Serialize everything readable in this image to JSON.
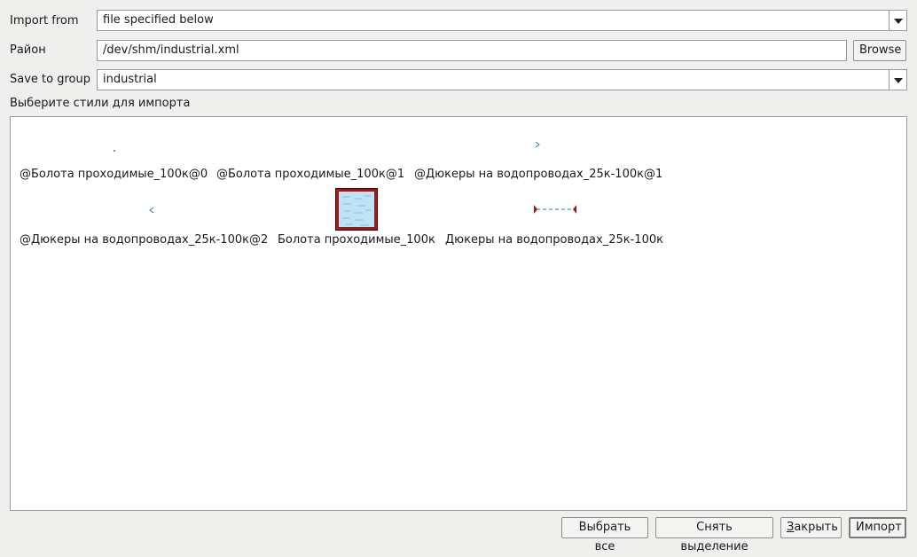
{
  "import_from": {
    "label": "Import from",
    "value": "file specified below"
  },
  "file": {
    "label": "Район",
    "value": "/dev/shm/industrial.xml",
    "browse_label": "Browse"
  },
  "save_to_group": {
    "label": "Save to group",
    "value": "industrial"
  },
  "styles_heading": "Выберите стили для импорта",
  "styles": [
    {
      "name": "@Болота проходимые_100к@0",
      "icon": "dot-marker-icon"
    },
    {
      "name": "@Болота проходимые_100к@1",
      "icon": "empty-preview"
    },
    {
      "name": "@Дюкеры на водопроводах_25к-100к@1",
      "icon": "chevron-right-icon"
    },
    {
      "name": "@Дюкеры на водопроводах_25к-100к@2",
      "icon": "chevron-left-icon"
    },
    {
      "name": "Болота проходимые_100к",
      "icon": "swamp-fill-icon"
    },
    {
      "name": "Дюкеры на водопроводах_25к-100к",
      "icon": "dashed-line-icon"
    }
  ],
  "buttons": {
    "select_all": "Выбрать все",
    "deselect": "Снять выделение",
    "close_first": "З",
    "close_rest": "акрыть",
    "import": "Импорт"
  },
  "colors": {
    "swamp_border": "#a01818",
    "swamp_fill": "#bfe3f5",
    "dash": "#3a6fa8"
  }
}
